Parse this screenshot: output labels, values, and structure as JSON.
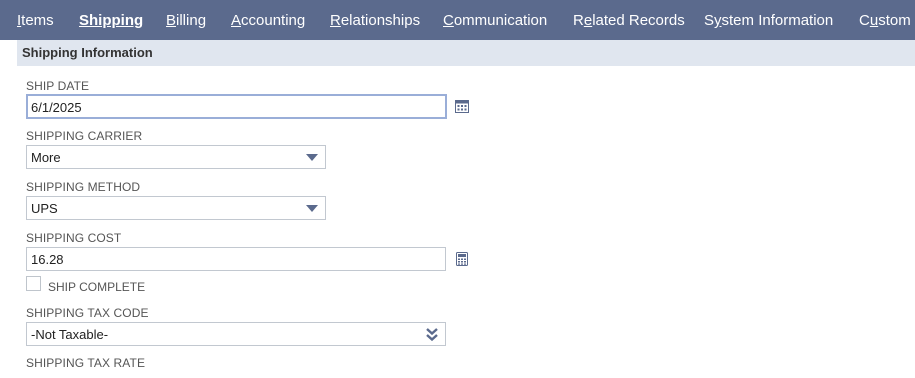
{
  "tabs": [
    {
      "first": "I",
      "rest": "tems",
      "active": false
    },
    {
      "first": "S",
      "rest": "hipping",
      "active": true
    },
    {
      "first": "B",
      "rest": "illing",
      "active": false
    },
    {
      "first": "A",
      "rest": "ccounting",
      "active": false
    },
    {
      "first": "R",
      "rest": "elationships",
      "active": false
    },
    {
      "first": "C",
      "rest": "ommunication",
      "active": false
    },
    {
      "pre": "R",
      "first": "e",
      "rest": "lated Records",
      "active": false
    },
    {
      "pre": "S",
      "first": "y",
      "rest": "stem Information",
      "active": false
    },
    {
      "pre": "C",
      "first": "u",
      "rest": "stom",
      "active": false
    }
  ],
  "section": {
    "title": "Shipping Information"
  },
  "fields": {
    "ship_date": {
      "label": "SHIP DATE",
      "value": "6/1/2025",
      "icon": "calendar-icon"
    },
    "shipping_carrier": {
      "label": "SHIPPING CARRIER",
      "value": "More"
    },
    "shipping_method": {
      "label": "SHIPPING METHOD",
      "value": "UPS"
    },
    "shipping_cost": {
      "label": "SHIPPING COST",
      "value": "16.28",
      "icon": "calculator-icon"
    },
    "ship_complete": {
      "label": "SHIP COMPLETE",
      "checked": false
    },
    "shipping_tax_code": {
      "label": "SHIPPING TAX CODE",
      "value": "-Not Taxable-"
    },
    "shipping_tax_rate": {
      "label": "SHIPPING TAX RATE"
    }
  },
  "colors": {
    "tabbar": "#5b6a8d",
    "section": "#e0e6ef",
    "focus": "#9aaed8"
  }
}
